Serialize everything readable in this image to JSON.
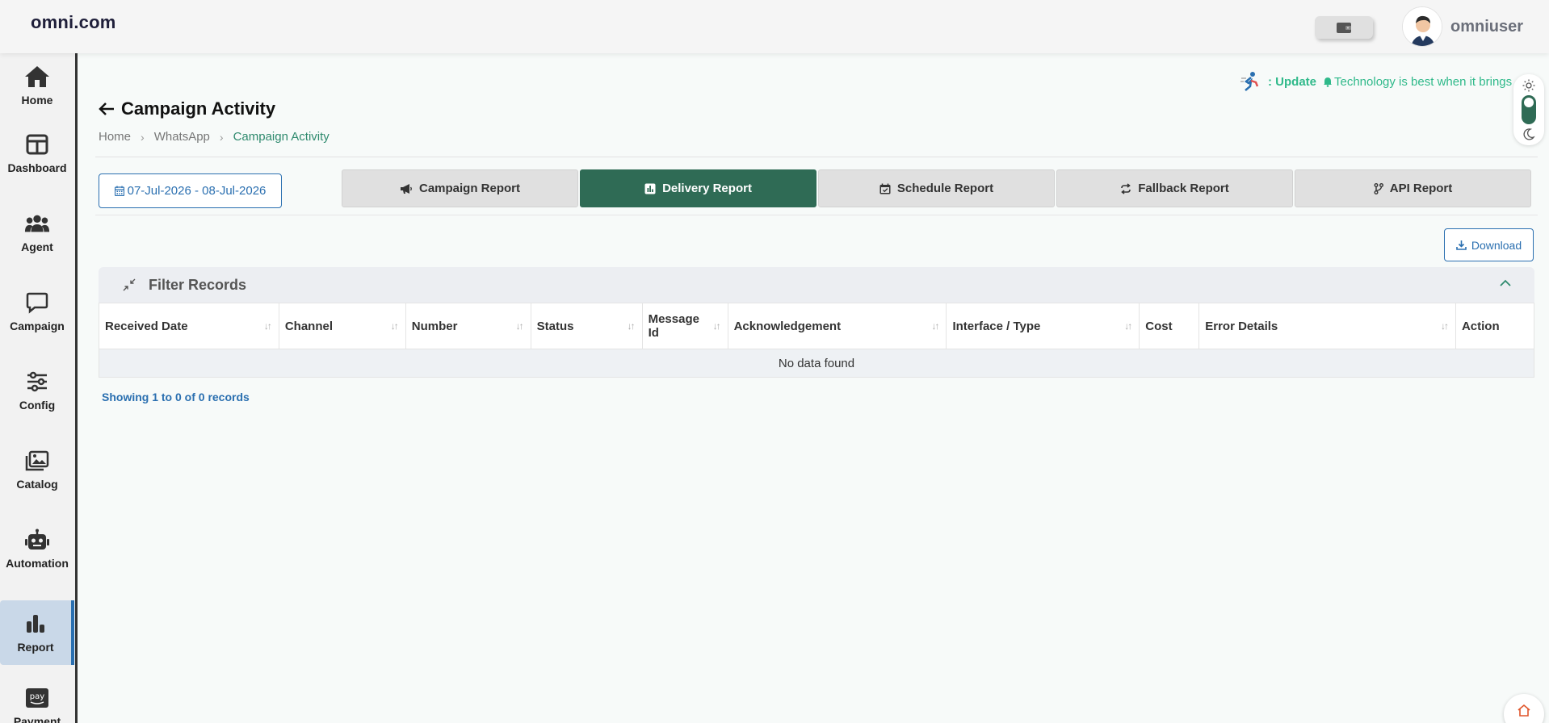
{
  "header": {
    "brand": "omni.com",
    "username": "omniuser"
  },
  "sidebar": {
    "items": [
      {
        "label": "Home",
        "icon": "home-icon"
      },
      {
        "label": "Dashboard",
        "icon": "dashboard-icon"
      },
      {
        "label": "Agent",
        "icon": "users-icon"
      },
      {
        "label": "Campaign",
        "icon": "chat-icon"
      },
      {
        "label": "Config",
        "icon": "sliders-icon"
      },
      {
        "label": "Catalog",
        "icon": "images-icon"
      },
      {
        "label": "Automation",
        "icon": "robot-icon"
      },
      {
        "label": "Report",
        "icon": "bar-chart-icon",
        "active": true
      },
      {
        "label": "Payment",
        "icon": "amazon-pay-icon",
        "badge": "pay"
      }
    ]
  },
  "ticker": {
    "prefix": ": Update",
    "text": "Technology is best when it brings"
  },
  "page": {
    "title": "Campaign Activity",
    "breadcrumb": [
      "Home",
      "WhatsApp",
      "Campaign Activity"
    ]
  },
  "date_range": "07-Jul-2026 - 08-Jul-2026",
  "tabs": [
    {
      "label": "Campaign Report",
      "icon": "megaphone-icon"
    },
    {
      "label": "Delivery Report",
      "icon": "report-icon",
      "active": true
    },
    {
      "label": "Schedule Report",
      "icon": "calendar-check-icon"
    },
    {
      "label": "Fallback Report",
      "icon": "repeat-icon"
    },
    {
      "label": "API Report",
      "icon": "branch-icon"
    }
  ],
  "download_label": "Download",
  "filter": {
    "title": "Filter Records"
  },
  "table": {
    "columns": [
      "Received Date",
      "Channel",
      "Number",
      "Status",
      "Message Id",
      "Acknowledgement",
      "Interface / Type",
      "Cost",
      "Error Details",
      "Action"
    ],
    "empty_message": "No data found"
  },
  "footer": {
    "showing": "Showing 1 to 0 of 0 records"
  },
  "colors": {
    "accent_green": "#2f6b55",
    "link_blue": "#2a6fb0",
    "ticker_green": "#2fb98a"
  }
}
